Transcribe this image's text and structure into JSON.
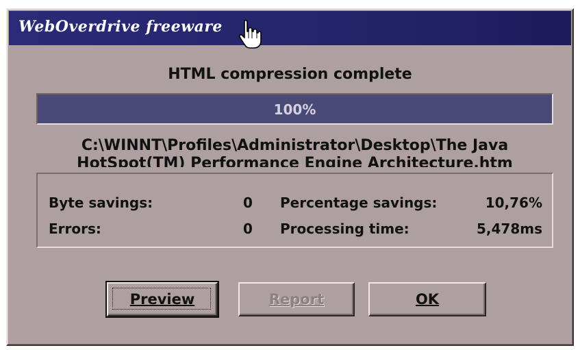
{
  "window": {
    "title": "WebOverdrive freeware"
  },
  "status": {
    "heading": "HTML compression complete"
  },
  "progress": {
    "percent_label": "100%",
    "fraction": 1.0
  },
  "file": {
    "path_line1": "C:\\WINNT\\Profiles\\Administrator\\Desktop\\The Java",
    "path_line2": "HotSpot(TM) Performance Engine Architecture.htm"
  },
  "stats": {
    "byte_savings_label": "Byte savings:",
    "byte_savings_value": "0",
    "errors_label": "Errors:",
    "errors_value": "0",
    "percentage_savings_label": "Percentage savings:",
    "percentage_savings_value": "10,76%",
    "processing_time_label": "Processing time:",
    "processing_time_value": "5,478ms"
  },
  "buttons": {
    "preview_label": "Preview",
    "report_label": "Report",
    "ok_label": "OK"
  },
  "colors": {
    "dialog_bg": "#aea0a0",
    "titlebar": "#2a2a78",
    "progress_fill": "#4a4a76"
  },
  "icons": {
    "cursor": "hand-pointer-icon"
  }
}
